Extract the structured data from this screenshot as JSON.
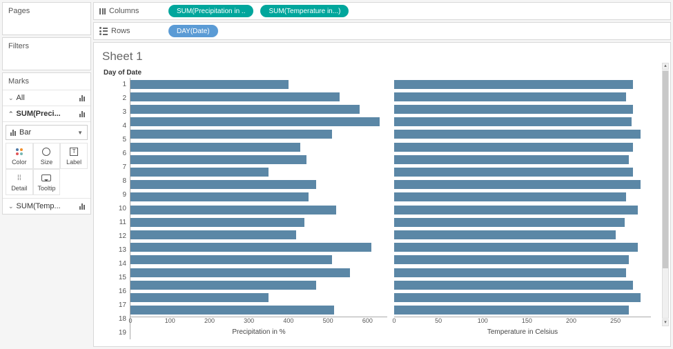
{
  "left_panels": {
    "pages": "Pages",
    "filters": "Filters"
  },
  "marks": {
    "title": "Marks",
    "all": "All",
    "sum_precip": "SUM(Preci...",
    "sum_temp": "SUM(Temp...",
    "type": "Bar",
    "cells": {
      "color": "Color",
      "size": "Size",
      "label": "Label",
      "detail": "Detail",
      "tooltip": "Tooltip"
    }
  },
  "shelves": {
    "columns_label": "Columns",
    "rows_label": "Rows",
    "col_pill1": "SUM(Precipitation in ..",
    "col_pill2": "SUM(Temperature in...)",
    "row_pill1": "DAY(Date)"
  },
  "sheet": {
    "title": "Sheet 1",
    "y_axis_title": "Day of Date",
    "x1_label": "Precipitation in %",
    "x2_label": "Temperature in Celsius"
  },
  "chart_data": [
    {
      "type": "bar",
      "orientation": "horizontal",
      "title": "",
      "xlabel": "Precipitation in %",
      "ylabel": "Day of Date",
      "xlim": [
        0,
        650
      ],
      "ticks": [
        0,
        100,
        200,
        300,
        400,
        500,
        600
      ],
      "categories": [
        1,
        2,
        3,
        4,
        5,
        6,
        7,
        8,
        9,
        10,
        11,
        12,
        13,
        14,
        15,
        16,
        17,
        18,
        19
      ],
      "values": [
        400,
        530,
        580,
        630,
        510,
        430,
        445,
        350,
        470,
        450,
        520,
        440,
        420,
        610,
        510,
        555,
        470,
        350,
        515
      ]
    },
    {
      "type": "bar",
      "orientation": "horizontal",
      "title": "",
      "xlabel": "Temperature in Celsius",
      "ylabel": "Day of Date",
      "xlim": [
        0,
        290
      ],
      "ticks": [
        0,
        50,
        100,
        150,
        200,
        250
      ],
      "categories": [
        1,
        2,
        3,
        4,
        5,
        6,
        7,
        8,
        9,
        10,
        11,
        12,
        13,
        14,
        15,
        16,
        17,
        18,
        19
      ],
      "values": [
        270,
        262,
        270,
        268,
        278,
        270,
        265,
        270,
        278,
        262,
        275,
        260,
        250,
        275,
        265,
        262,
        270,
        278,
        265
      ]
    }
  ]
}
